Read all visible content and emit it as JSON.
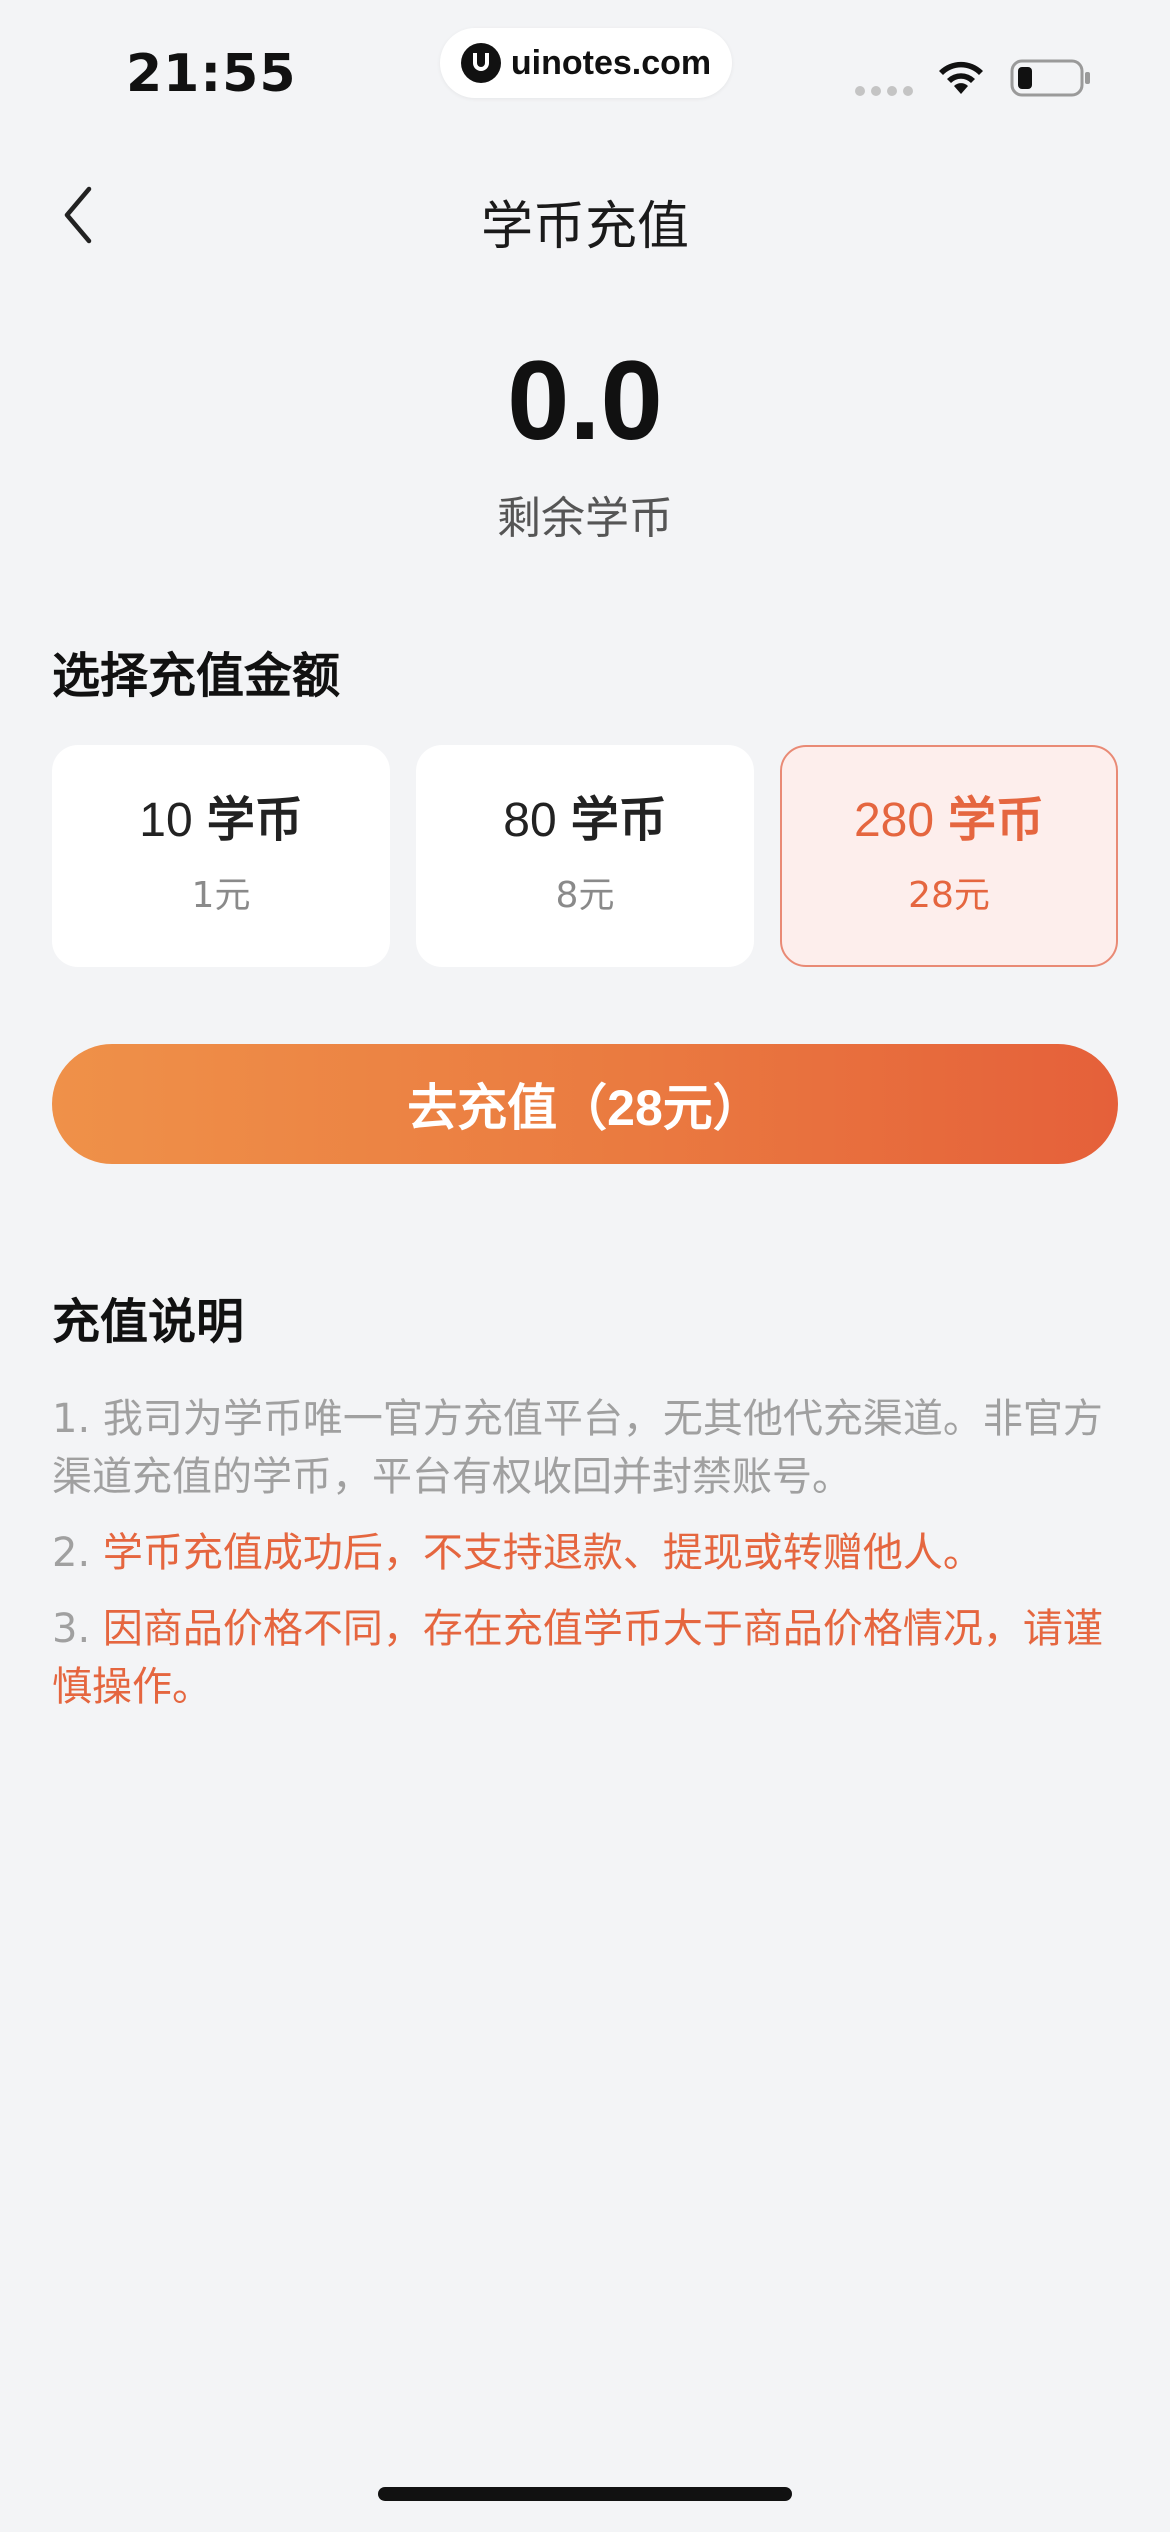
{
  "status_bar": {
    "time": "21:55",
    "watermark": "uinotes.com",
    "icons": [
      "signal-dots-icon",
      "wifi-icon",
      "battery-icon"
    ]
  },
  "nav": {
    "back_icon": "chevron-left-icon",
    "title": "学币充值"
  },
  "balance": {
    "value": "0.0",
    "label": "剩余学币"
  },
  "amount_section": {
    "title": "选择充值金额",
    "options": [
      {
        "amount": "10",
        "unit": "学币",
        "price": "1元",
        "selected": false
      },
      {
        "amount": "80",
        "unit": "学币",
        "price": "8元",
        "selected": false
      },
      {
        "amount": "280",
        "unit": "学币",
        "price": "28元",
        "selected": true
      }
    ]
  },
  "recharge_button": {
    "label": "去充值（28元）"
  },
  "notes": {
    "title": "充值说明",
    "items": [
      {
        "num": "1.",
        "text": "我司为学币唯一官方充值平台，无其他代充渠道。非官方渠道充值的学币，平台有权收回并封禁账号。",
        "style": "gray"
      },
      {
        "num": "2.",
        "text": "学币充值成功后，不支持退款、提现或转赠他人。",
        "style": "red"
      },
      {
        "num": "3.",
        "text": "因商品价格不同，存在充值学币大于商品价格情况，请谨慎操作。",
        "style": "red"
      }
    ]
  },
  "colors": {
    "accent": "#e5663f",
    "button_gradient_start": "#ef9149",
    "button_gradient_end": "#e5603a",
    "selected_bg": "#fdeeec",
    "page_bg": "#f3f4f6"
  }
}
